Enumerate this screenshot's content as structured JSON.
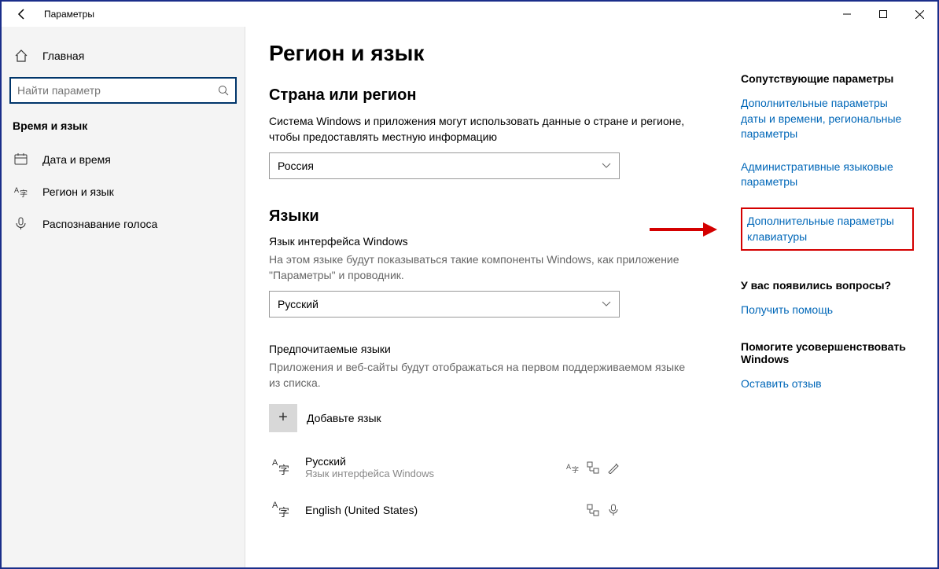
{
  "window": {
    "title": "Параметры"
  },
  "sidebar": {
    "home": "Главная",
    "search_placeholder": "Найти параметр",
    "category": "Время и язык",
    "items": [
      {
        "label": "Дата и время"
      },
      {
        "label": "Регион и язык"
      },
      {
        "label": "Распознавание голоса"
      }
    ]
  },
  "page": {
    "title": "Регион и язык",
    "country": {
      "heading": "Страна или регион",
      "desc": "Система Windows и приложения могут использовать данные о стране и регионе, чтобы предоставлять местную информацию",
      "value": "Россия"
    },
    "languages": {
      "heading": "Языки",
      "display_lang_label": "Язык интерфейса Windows",
      "display_lang_desc": "На этом языке будут показываться такие компоненты Windows, как приложение \"Параметры\" и проводник.",
      "display_lang_value": "Русский",
      "preferred_label": "Предпочитаемые языки",
      "preferred_desc": "Приложения и веб-сайты будут отображаться на первом поддерживаемом языке из списка.",
      "add_language": "Добавьте язык",
      "items": [
        {
          "name": "Русский",
          "sub": "Язык интерфейса Windows"
        },
        {
          "name": "English (United States)",
          "sub": ""
        }
      ]
    }
  },
  "right": {
    "related_heading": "Сопутствующие параметры",
    "links": [
      "Дополнительные параметры даты и времени, региональные параметры",
      "Административные языковые параметры",
      "Дополнительные параметры клавиатуры"
    ],
    "questions_heading": "У вас появились вопросы?",
    "help_link": "Получить помощь",
    "improve_heading": "Помогите усовершенствовать Windows",
    "feedback_link": "Оставить отзыв"
  }
}
